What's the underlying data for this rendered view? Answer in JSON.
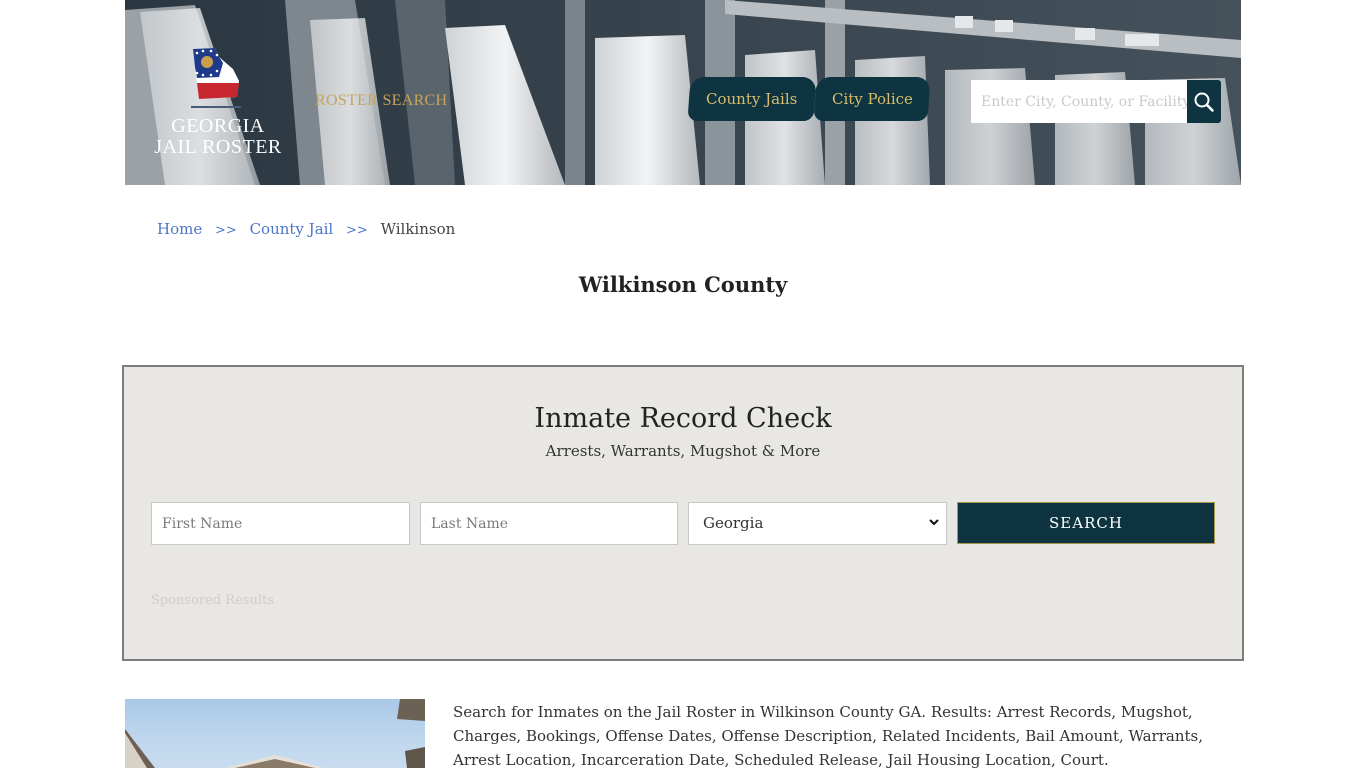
{
  "header": {
    "logo_line1": "GEORGIA",
    "logo_line2": "JAIL ROSTER",
    "roster_search_label": "ROSTER SEARCH",
    "nav": [
      {
        "label": "County Jails"
      },
      {
        "label": "City Police"
      }
    ],
    "search": {
      "placeholder": "Enter City, County, or Facility",
      "value": "",
      "button_icon": "search-icon"
    }
  },
  "breadcrumb": {
    "items": [
      {
        "label": "Home",
        "link": true
      },
      {
        "label": "County Jail",
        "link": true
      },
      {
        "label": "Wilkinson",
        "link": false
      }
    ],
    "separator": ">>"
  },
  "page_title": "Wilkinson County",
  "record_check": {
    "title": "Inmate Record Check",
    "subtitle": "Arrests, Warrants, Mugshot & More",
    "first_name": {
      "placeholder": "First Name",
      "value": ""
    },
    "last_name": {
      "placeholder": "Last Name",
      "value": ""
    },
    "state_select": {
      "selected": "Georgia"
    },
    "search_button": "SEARCH",
    "sponsored_label": "Sponsored Results"
  },
  "intro": {
    "text": "Search for Inmates on the Jail Roster in Wilkinson County GA. Results: Arrest Records, Mugshot, Charges, Bookings, Offense Dates, Offense Description, Related Incidents, Bail Amount, Warrants, Arrest Location, Incarceration Date, Scheduled Release, Jail Housing Location, Court."
  },
  "colors": {
    "brand_dark": "#0d3440",
    "gold": "#c6a55b",
    "link_blue": "#4a76c9",
    "panel_bg": "#e8e7e3"
  }
}
